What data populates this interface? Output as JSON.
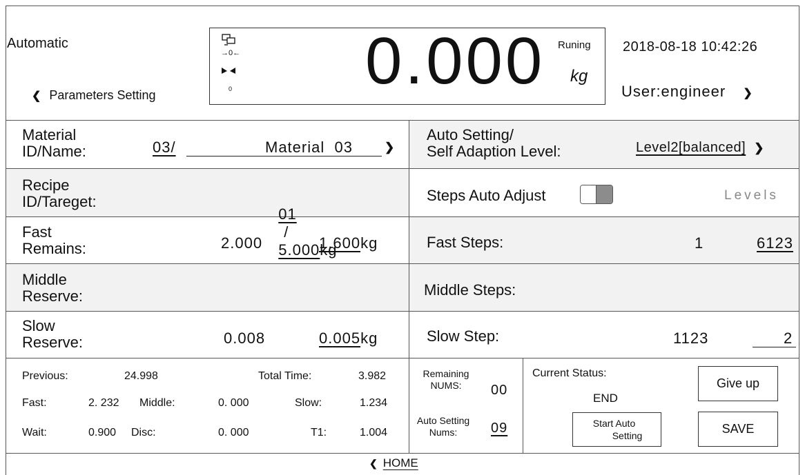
{
  "header": {
    "mode": "Automatic",
    "params_link": "Parameters Setting",
    "weight_value": "0.000",
    "weight_unit": "kg",
    "run_status": "Runing",
    "zero_indicator": "→0←",
    "small_zero": "0",
    "datetime": "2018-08-18 10:42:26",
    "user": "User:engineer"
  },
  "left": {
    "material_label_1": "Material",
    "material_label_2": "ID/Name:",
    "material_id": "03/",
    "material_name": "Material  03",
    "recipe_label_1": "Recipe",
    "recipe_label_2": "ID/Tareget:",
    "recipe_id": "01",
    "recipe_sep": "/",
    "recipe_target": "5.000",
    "recipe_unit": "kg",
    "fast_label_1": "Fast",
    "fast_label_2": "Remains:",
    "fast_current": "2.000",
    "fast_set": "1.600",
    "fast_unit": "kg",
    "middle_label_1": "Middle",
    "middle_label_2": "Reserve:",
    "slow_label_1": "Slow",
    "slow_label_2": "Reserve:",
    "slow_current": "0.008",
    "slow_set": "0.005",
    "slow_unit": "kg"
  },
  "right": {
    "auto_label_1": "Auto Setting/",
    "auto_label_2": "Self Adaption Level:",
    "auto_level": "Level2[balanced]",
    "steps_auto_adjust": "Steps Auto Adjust",
    "levels": "Levels",
    "fast_steps_label": "Fast Steps:",
    "fast_steps_current": "1",
    "fast_steps_set": "6123",
    "middle_steps_label": "Middle Steps:",
    "slow_step_label": "Slow Step:",
    "slow_step_current": "1123",
    "slow_step_set": "2"
  },
  "stats": {
    "previous_label": "Previous:",
    "previous_value": "24.998",
    "total_time_label": "Total Time:",
    "total_time_value": "3.982",
    "fast_label": "Fast:",
    "fast_value": "2. 232",
    "middle_label": "Middle:",
    "middle_value": "0. 000",
    "slow_label": "Slow:",
    "slow_value": "1.234",
    "wait_label": "Wait:",
    "wait_value": "0.900",
    "disc_label": "Disc:",
    "disc_value": "0. 000",
    "t1_label": "T1:",
    "t1_value": "1.004"
  },
  "counts": {
    "remaining_label_1": "Remaining",
    "remaining_label_2": "NUMS:",
    "remaining_value": "00",
    "auto_nums_label_1": "Auto Setting",
    "auto_nums_label_2": "Nums:",
    "auto_nums_value": "09"
  },
  "status": {
    "current_status_label": "Current Status:",
    "current_status_value": "END",
    "start_auto_1": "Start Auto",
    "start_auto_2": "Setting",
    "give_up": "Give up",
    "save": "SAVE"
  },
  "footer": {
    "home": "HOME"
  },
  "colors": {
    "border": "#555555",
    "shade": "#f2f2f2",
    "toggle": "#8c8c8c"
  }
}
